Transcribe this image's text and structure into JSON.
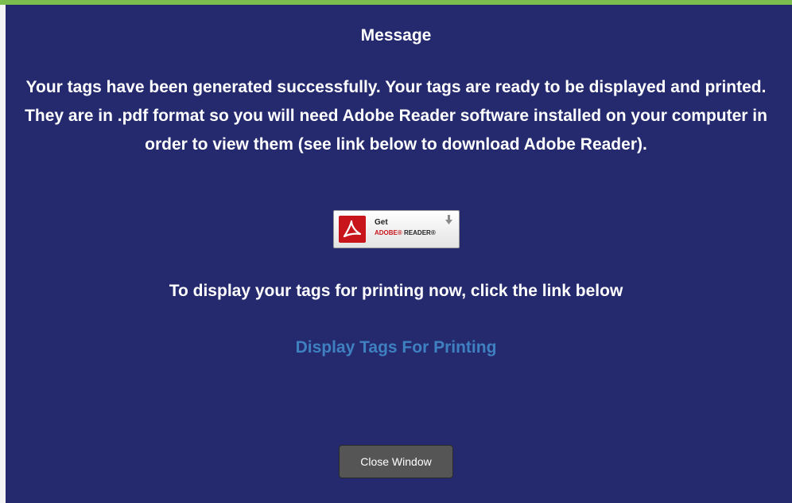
{
  "dialog": {
    "title": "Message",
    "body": "Your tags have been generated successfully. Your tags are ready to be displayed and printed. They are in .pdf format so you will need Adobe Reader software installed on your computer in order to view them (see link below to download Adobe Reader).",
    "reader_badge": {
      "get_label": "Get",
      "adobe_label": "ADOBE",
      "reader_label": "READER",
      "registered_mark": "®",
      "icons": [
        "adobe-pdf-icon",
        "download-arrow-icon"
      ]
    },
    "instruction": "To display your tags for printing now, click the link below",
    "display_link_label": "Display Tags For Printing",
    "close_button_label": "Close Window"
  },
  "colors": {
    "panel_background": "#252a6f",
    "top_accent": "#7cbd4f",
    "text": "#ffffff",
    "link": "#3f80c1",
    "button_background": "#555555",
    "adobe_red": "#c8151b"
  }
}
